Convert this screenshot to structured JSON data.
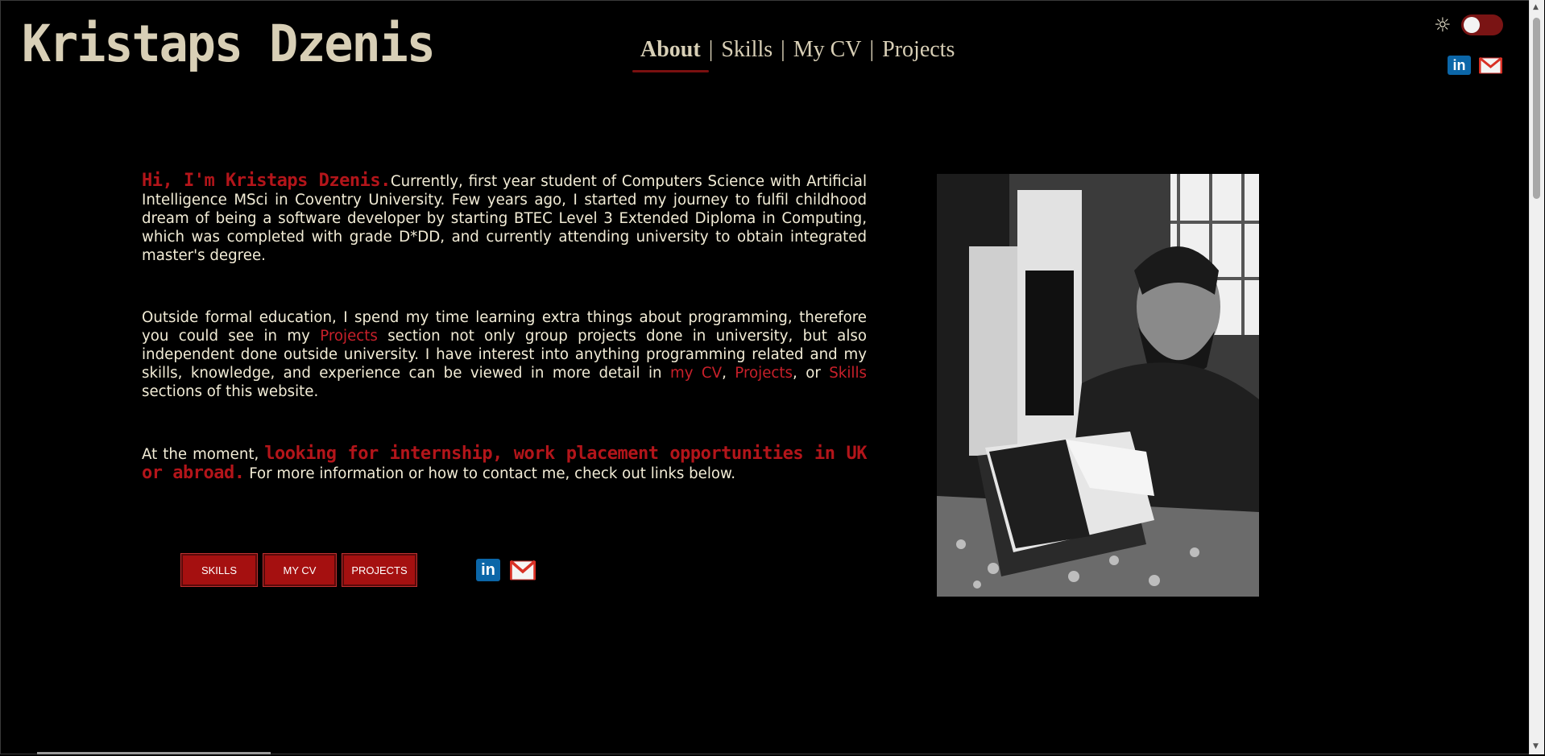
{
  "site": {
    "title": "Kristaps Dzenis"
  },
  "nav": {
    "items": [
      {
        "label": "About"
      },
      {
        "label": "Skills"
      },
      {
        "label": "My CV"
      },
      {
        "label": "Projects"
      }
    ],
    "separator": "|"
  },
  "theme_toggle": {
    "icon": "sun-icon"
  },
  "social": {
    "linkedin_icon": "linkedin-icon",
    "linkedin_glyph": "in",
    "gmail_icon": "gmail-icon"
  },
  "intro": {
    "greeting": "Hi, I'm Kristaps Dzenis.",
    "p1": "Currently, first year student of Computers Science with Artificial Intelligence MSci in Coventry University. Few years ago, I started my journey to fulfil childhood dream of being a software developer by starting BTEC Level 3 Extended Diploma in Computing, which was completed with grade D*DD, and currently attending university to obtain integrated master's degree.",
    "p2_a": "Outside formal education, I spend my time learning extra things about programming, therefore you could see in my ",
    "p2_link_projects": "Projects",
    "p2_b": " section not only group projects done in university, but also independent done outside university. I have interest into anything programming related and my skills, knowledge, and experience can be viewed in more detail in ",
    "p2_link_cv": "my CV",
    "p2_comma": ", ",
    "p2_link_projects2": "Projects",
    "p2_or": ", or ",
    "p2_link_skills": "Skills",
    "p2_c": " sections of this website.",
    "p3_a": "At the moment, ",
    "p3_highlight": "looking for internship, work placement opportunities in UK or abroad.",
    "p3_b": " For more information or how to contact me, check out links below."
  },
  "buttons": {
    "skills": "SKILLS",
    "cv": "MY CV",
    "projects": "PROJECTS"
  },
  "colors": {
    "accent": "#b3151a",
    "background": "#000000",
    "text": "#f2ecd6"
  }
}
